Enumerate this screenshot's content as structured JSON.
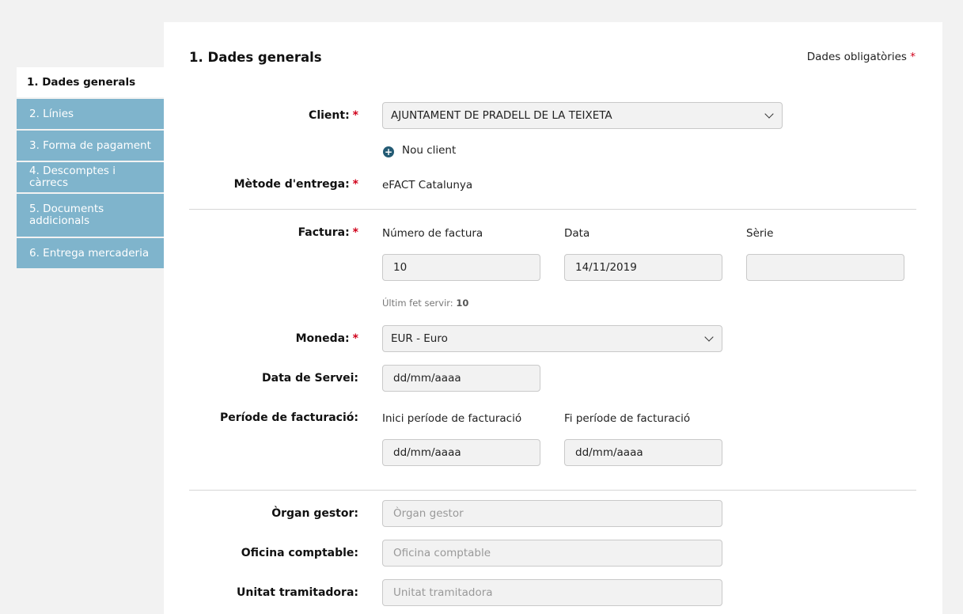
{
  "sidebar": {
    "items": [
      {
        "label": "1. Dades generals"
      },
      {
        "label": "2. Línies"
      },
      {
        "label": "3. Forma de pagament"
      },
      {
        "label": "4. Descomptes i càrrecs"
      },
      {
        "label": "5. Documents addicionals"
      },
      {
        "label": "6. Entrega mercaderia"
      }
    ]
  },
  "section": {
    "title": "1. Dades generals",
    "mandatory_note": "Dades obligatòries",
    "required_marker": "*"
  },
  "client": {
    "label": "Client:",
    "value": "AJUNTAMENT DE PRADELL DE LA TEIXETA",
    "new_client_label": "Nou client"
  },
  "delivery": {
    "label": "Mètode d'entrega:",
    "value": "eFACT Catalunya"
  },
  "invoice": {
    "label": "Factura:",
    "number_label": "Número de factura",
    "number_value": "10",
    "date_label": "Data",
    "date_value": "14/11/2019",
    "series_label": "Sèrie",
    "series_value": "",
    "last_used_label": "Últim fet servir:",
    "last_used_value": "10"
  },
  "currency": {
    "label": "Moneda:",
    "value": "EUR - Euro"
  },
  "service_date": {
    "label": "Data de Servei:",
    "placeholder": "dd/mm/aaaa"
  },
  "billing_period": {
    "label": "Període de facturació:",
    "start_label": "Inici període de facturació",
    "start_placeholder": "dd/mm/aaaa",
    "end_label": "Fi període de facturació",
    "end_placeholder": "dd/mm/aaaa"
  },
  "organ_gestor": {
    "label": "Òrgan gestor:",
    "placeholder": "Òrgan gestor"
  },
  "oficina_comptable": {
    "label": "Oficina comptable:",
    "placeholder": "Oficina comptable"
  },
  "unitat_tramitadora": {
    "label": "Unitat tramitadora:",
    "placeholder": "Unitat tramitadora"
  },
  "colors": {
    "sidebar_bg": "#7fb4cc",
    "required": "#d0021b",
    "plus_icon": "#245b74"
  }
}
